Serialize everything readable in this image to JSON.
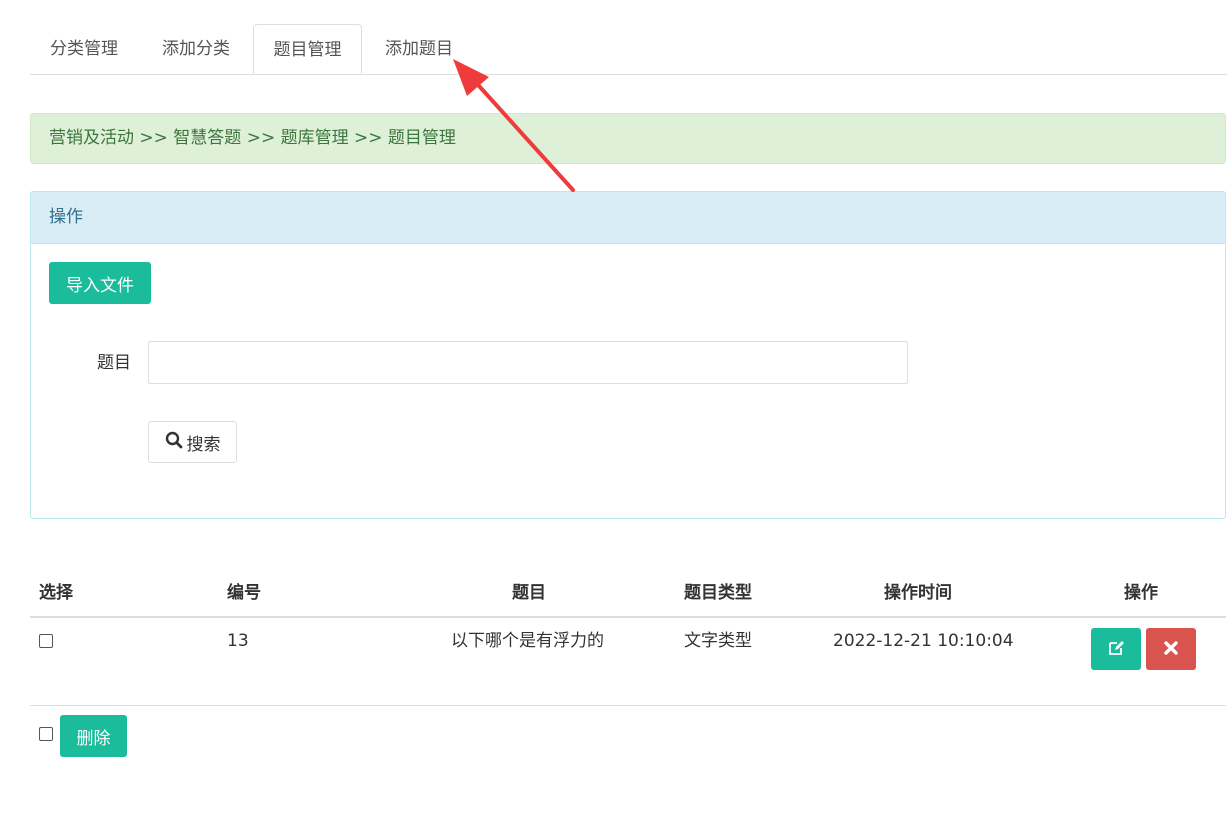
{
  "tabs": [
    {
      "label": "分类管理",
      "active": false
    },
    {
      "label": "添加分类",
      "active": false
    },
    {
      "label": "题目管理",
      "active": true
    },
    {
      "label": "添加题目",
      "active": false
    }
  ],
  "breadcrumb": "营销及活动 >> 智慧答题 >> 题库管理 >> 题目管理",
  "panel": {
    "heading": "操作",
    "import_label": "导入文件",
    "field_label": "题目",
    "field_value": "",
    "field_placeholder": "",
    "search_label": "搜索"
  },
  "table": {
    "headers": [
      "选择",
      "编号",
      "题目",
      "题目类型",
      "操作时间",
      "操作"
    ],
    "rows": [
      {
        "id": "13",
        "title": "以下哪个是有浮力的",
        "type": "文字类型",
        "time": "2022-12-21 10:10:04"
      }
    ]
  },
  "footer": {
    "delete_label": "删除"
  },
  "colors": {
    "accent": "#1abc9c",
    "danger": "#d9534f",
    "annotation": "#ee3b3b"
  }
}
